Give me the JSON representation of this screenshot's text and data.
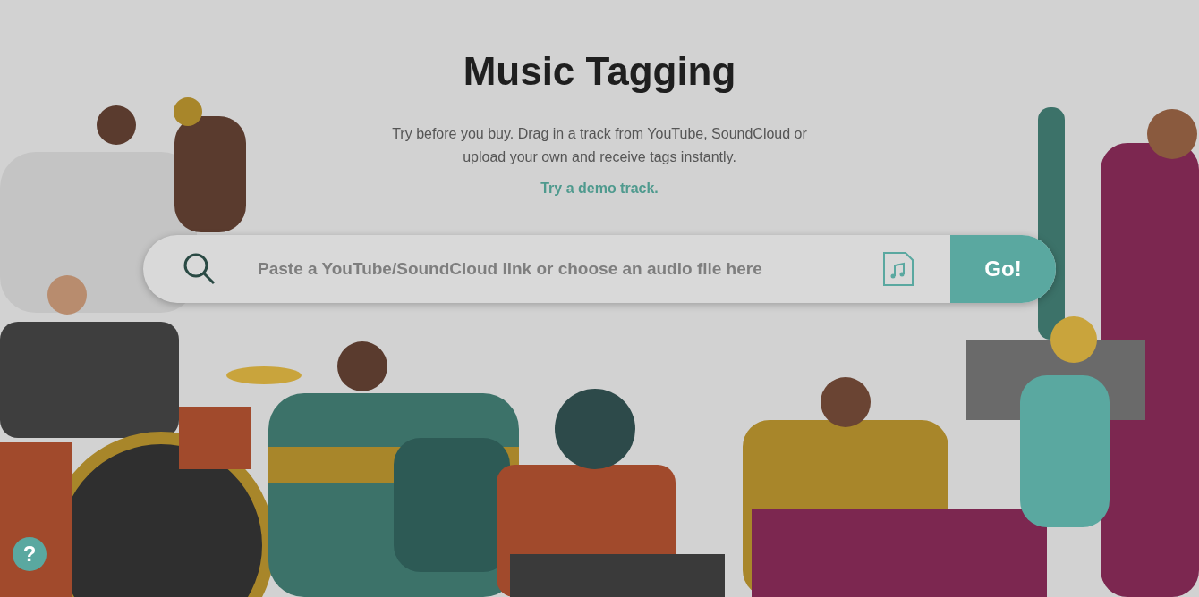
{
  "title": "Music Tagging",
  "intro": "Try before you buy. Drag in a track from YouTube, SoundCloud or upload your own and receive tags instantly.",
  "demo_link": "Try a demo track.",
  "search": {
    "placeholder": "Paste a YouTube/SoundCloud link or choose an audio file here"
  },
  "go_button": "Go!",
  "help_button": "?"
}
